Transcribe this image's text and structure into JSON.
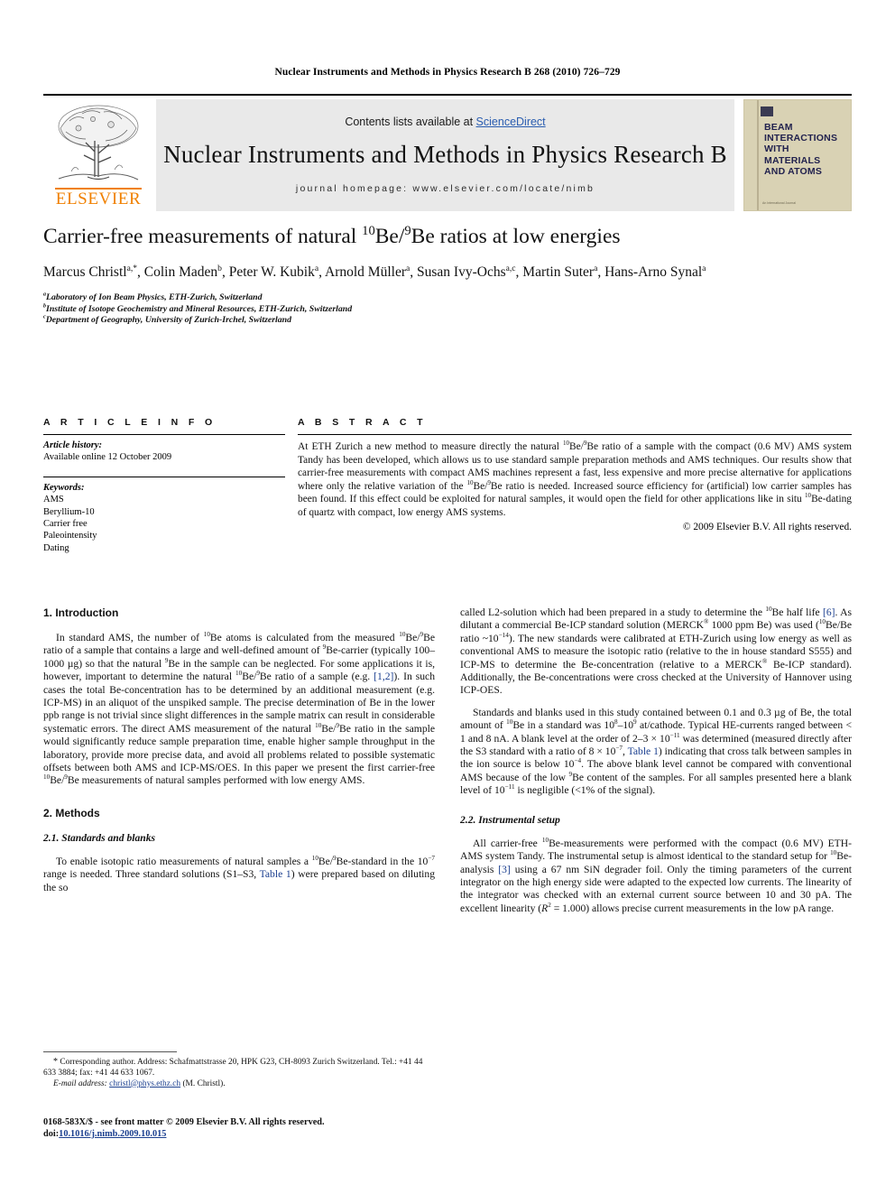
{
  "running_head": "Nuclear Instruments and Methods in Physics Research B 268 (2010) 726–729",
  "masthead": {
    "contents_prefix": "Contents lists available at ",
    "sciencedirect": "ScienceDirect",
    "journal_title": "Nuclear Instruments and Methods in Physics Research B",
    "homepage": "journal homepage: www.elsevier.com/locate/nimb",
    "publisher": "ELSEVIER",
    "cover": {
      "line1": "BEAM",
      "line2": "INTERACTIONS",
      "line3": "WITH",
      "line4": "MATERIALS",
      "line5": "AND ATOMS",
      "footer": "An International Journal"
    },
    "colors": {
      "elsevier_orange": "#F08000",
      "link_blue": "#2a5db0",
      "band_gray": "#e9e9e9",
      "cover_tan": "#d9d2b4",
      "cover_navy": "#22224e"
    }
  },
  "article": {
    "title_part1": "Carrier-free measurements of natural ",
    "title_sup1": "10",
    "title_part2": "Be/",
    "title_sup2": "9",
    "title_part3": "Be ratios at low energies",
    "authors": "Marcus Christl a,*, Colin Maden b, Peter W. Kubik a, Arnold Müller a, Susan Ivy-Ochs a,c, Martin Suter a, Hans-Arno Synal a",
    "affiliations": [
      {
        "marker": "a",
        "text": "Laboratory of Ion Beam Physics, ETH-Zurich, Switzerland"
      },
      {
        "marker": "b",
        "text": "Institute of Isotope Geochemistry and Mineral Resources, ETH-Zurich, Switzerland"
      },
      {
        "marker": "c",
        "text": "Department of Geography, University of Zurich-Irchel, Switzerland"
      }
    ]
  },
  "article_info": {
    "heading": "A R T I C L E   I N F O",
    "history_label": "Article history:",
    "history_value": "Available online 12 October 2009",
    "keywords_label": "Keywords:",
    "keywords": [
      "AMS",
      "Beryllium-10",
      "Carrier free",
      "Paleointensity",
      "Dating"
    ]
  },
  "abstract": {
    "heading": "A B S T R A C T",
    "text": "At ETH Zurich a new method to measure directly the natural 10Be/9Be ratio of a sample with the compact (0.6 MV) AMS system Tandy has been developed, which allows us to use standard sample preparation methods and AMS techniques. Our results show that carrier-free measurements with compact AMS machines represent a fast, less expensive and more precise alternative for applications where only the relative variation of the 10Be/9Be ratio is needed. Increased source efficiency for (artificial) low carrier samples has been found. If this effect could be exploited for natural samples, it would open the field for other applications like in situ 10Be-dating of quartz with compact, low energy AMS systems.",
    "copyright": "© 2009 Elsevier B.V. All rights reserved."
  },
  "sections": {
    "intro_heading": "1. Introduction",
    "intro_p1": "In standard AMS, the number of 10Be atoms is calculated from the measured 10Be/9Be ratio of a sample that contains a large and well-defined amount of 9Be-carrier (typically 100–1000 µg) so that the natural 9Be in the sample can be neglected. For some applications it is, however, important to determine the natural 10Be/9Be ratio of a sample (e.g. [1,2]). In such cases the total Be-concentration has to be determined by an additional measurement (e.g. ICP-MS) in an aliquot of the unspiked sample. The precise determination of Be in the lower ppb range is not trivial since slight differences in the sample matrix can result in considerable systematic errors. The direct AMS measurement of the natural 10Be/9Be ratio in the sample would significantly reduce sample preparation time, enable higher sample throughput in the laboratory, provide more precise data, and avoid all problems related to possible systematic offsets between both AMS and ICP-MS/OES. In this paper we present the first carrier-free 10Be/9Be measurements of natural samples performed with low energy AMS.",
    "methods_heading": "2. Methods",
    "sub21_heading": "2.1. Standards and blanks",
    "sub21_p1": "To enable isotopic ratio measurements of natural samples a 10Be/9Be-standard in the 10−7 range is needed. Three standard solutions (S1–S3, Table 1) were prepared based on diluting the so called L2-solution which had been prepared in a study to determine the 10Be half life [6]. As dilutant a commercial Be-ICP standard solution (MERCK® 1000 ppm Be) was used (10Be/Be ratio ~10−14). The new standards were calibrated at ETH-Zurich using low energy as well as conventional AMS to measure the isotopic ratio (relative to the in house standard S555) and ICP-MS to determine the Be-concentration (relative to a MERCK® Be-ICP standard). Additionally, the Be-concentrations were cross checked at the University of Hannover using ICP-OES.",
    "sub21_p2": "Standards and blanks used in this study contained between 0.1 and 0.3 µg of Be, the total amount of 10Be in a standard was 108–109 at/cathode. Typical HE-currents ranged between < 1 and 8 nA. A blank level at the order of 2–3 × 10−11 was determined (measured directly after the S3 standard with a ratio of 8 × 10−7, Table 1) indicating that cross talk between samples in the ion source is below 10−4. The above blank level cannot be compared with conventional AMS because of the low 9Be content of the samples. For all samples presented here a blank level of 10−11 is negligible (<1% of the signal).",
    "sub22_heading": "2.2. Instrumental setup",
    "sub22_p1": "All carrier-free 10Be-measurements were performed with the compact (0.6 MV) ETH-AMS system Tandy. The instrumental setup is almost identical to the standard setup for 10Be-analysis [3] using a 67 nm SiN degrader foil. Only the timing parameters of the current integrator on the high energy side were adapted to the expected low currents. The linearity of the integrator was checked with an external current source between 10 and 30 pA. The excellent linearity (R2 = 1.000) allows precise current measurements in the low pA range."
  },
  "footnotes": {
    "corresponding": "Corresponding author. Address: Schafmattstrasse 20, HPK G23, CH-8093 Zurich Switzerland. Tel.: +41 44 633 3884; fax: +41 44 633 1067.",
    "email_label": "E-mail address:",
    "email": "christl@phys.ethz.ch",
    "email_suffix": "(M. Christl)."
  },
  "issn": {
    "front_matter": "0168-583X/$ - see front matter © 2009 Elsevier B.V. All rights reserved.",
    "doi_label": "doi:",
    "doi_value": "10.1016/j.nimb.2009.10.015"
  }
}
